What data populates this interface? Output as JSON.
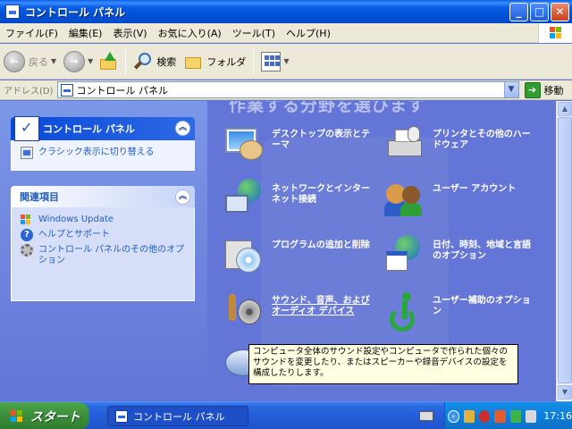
{
  "window": {
    "title": "コントロール パネル",
    "min": "_",
    "max": "□",
    "close": "✕"
  },
  "menu": [
    "ファイル(F)",
    "編集(E)",
    "表示(V)",
    "お気に入り(A)",
    "ツール(T)",
    "ヘルプ(H)"
  ],
  "toolbar": {
    "back": "戻る",
    "search": "検索",
    "folders": "フォルダ"
  },
  "address": {
    "label": "アドレス(D)",
    "value": "コントロール パネル",
    "go": "移動"
  },
  "sidebar": {
    "panel_title": "コントロール パネル",
    "switch_link": "クラシック表示に切り替える",
    "related_title": "関連項目",
    "related_links": [
      "Windows Update",
      "ヘルプとサポート",
      "コントロール パネルのその他のオプション"
    ]
  },
  "main": {
    "heading": "作業する分野を選びます",
    "categories": [
      {
        "label": "デスクトップの表示とテーマ",
        "icon": "appearance-icon"
      },
      {
        "label": "プリンタとその他のハードウェア",
        "icon": "printer-hardware-icon"
      },
      {
        "label": "ネットワークとインターネット接続",
        "icon": "network-icon"
      },
      {
        "label": "ユーザー アカウント",
        "icon": "user-accounts-icon"
      },
      {
        "label": "プログラムの追加と削除",
        "icon": "add-remove-programs-icon"
      },
      {
        "label": "日付、時刻、地域と言語のオプション",
        "icon": "date-time-language-icon"
      },
      {
        "label": "サウンド、音声、およびオーディオ デバイス",
        "icon": "sound-icon"
      },
      {
        "label": "ユーザー補助のオプション",
        "icon": "accessibility-icon"
      },
      {
        "label": "",
        "icon": "performance-icon"
      }
    ]
  },
  "tooltip": "コンピュータ全体のサウンド設定やコンピュータで作られた個々のサウンドを変更したり、またはスピーカーや録音デバイスの設定を構成したりします。",
  "taskbar": {
    "start": "スタート",
    "task": "コントロール パネル",
    "clock": "17:16"
  },
  "colors": {
    "titlebar": "#0a5fe6",
    "taskbar": "#245edb",
    "start": "#3c8f3c",
    "main_bg": "#6375d6"
  }
}
